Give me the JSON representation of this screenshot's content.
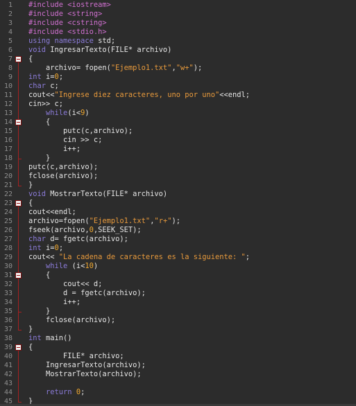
{
  "editor": {
    "language": "cpp",
    "colors": {
      "background": "#2c2c2c",
      "line_number": "#8f8f8f",
      "fold_marker": "#a82020",
      "preprocessor": "#d070d0",
      "keyword": "#8b7bd8",
      "string": "#e89a3c",
      "number": "#f0a830",
      "text": "#e6e6e6"
    },
    "fold_lines": [
      7,
      14,
      23,
      31,
      39
    ],
    "lines": [
      {
        "n": "1",
        "tokens": [
          [
            "pp",
            "#include <iostream>"
          ]
        ]
      },
      {
        "n": "2",
        "tokens": [
          [
            "pp",
            "#include <string>"
          ]
        ]
      },
      {
        "n": "3",
        "tokens": [
          [
            "pp",
            "#include <cstring>"
          ]
        ]
      },
      {
        "n": "4",
        "tokens": [
          [
            "pp",
            "#include <stdio.h>"
          ]
        ]
      },
      {
        "n": "5",
        "tokens": [
          [
            "kw",
            "using namespace "
          ],
          [
            "txt",
            "std;"
          ]
        ]
      },
      {
        "n": "6",
        "tokens": [
          [
            "ty",
            "void "
          ],
          [
            "txt",
            "IngresarTexto(FILE* archivo)"
          ]
        ]
      },
      {
        "n": "7",
        "tokens": [
          [
            "txt",
            "{"
          ]
        ]
      },
      {
        "n": "8",
        "tokens": [
          [
            "txt",
            "    archivo= fopen("
          ],
          [
            "str",
            "\"Ejemplo1.txt\""
          ],
          [
            "txt",
            ","
          ],
          [
            "str",
            "\"w+\""
          ],
          [
            "txt",
            ");"
          ]
        ]
      },
      {
        "n": "9",
        "tokens": [
          [
            "ty",
            "int "
          ],
          [
            "txt",
            "i="
          ],
          [
            "num",
            "0"
          ],
          [
            "txt",
            ";"
          ]
        ]
      },
      {
        "n": "10",
        "tokens": [
          [
            "ty",
            "char "
          ],
          [
            "txt",
            "c;"
          ]
        ]
      },
      {
        "n": "11",
        "tokens": [
          [
            "txt",
            "cout<<"
          ],
          [
            "str",
            "\"Ingrese diez caracteres, uno por uno\""
          ],
          [
            "txt",
            "<<endl;"
          ]
        ]
      },
      {
        "n": "12",
        "tokens": [
          [
            "txt",
            "cin>> c;"
          ]
        ]
      },
      {
        "n": "13",
        "tokens": [
          [
            "txt",
            "    "
          ],
          [
            "kw",
            "while"
          ],
          [
            "txt",
            "(i<"
          ],
          [
            "num",
            "9"
          ],
          [
            "txt",
            ")"
          ]
        ]
      },
      {
        "n": "14",
        "tokens": [
          [
            "txt",
            "    {"
          ]
        ]
      },
      {
        "n": "15",
        "tokens": [
          [
            "txt",
            "        putc(c,archivo);"
          ]
        ]
      },
      {
        "n": "16",
        "tokens": [
          [
            "txt",
            "        cin >> c;"
          ]
        ]
      },
      {
        "n": "17",
        "tokens": [
          [
            "txt",
            "        i++;"
          ]
        ]
      },
      {
        "n": "18",
        "tokens": [
          [
            "txt",
            "    }"
          ]
        ]
      },
      {
        "n": "19",
        "tokens": [
          [
            "txt",
            "putc(c,archivo);"
          ]
        ]
      },
      {
        "n": "20",
        "tokens": [
          [
            "txt",
            "fclose(archivo);"
          ]
        ]
      },
      {
        "n": "21",
        "tokens": [
          [
            "txt",
            "}"
          ]
        ]
      },
      {
        "n": "22",
        "tokens": [
          [
            "ty",
            "void "
          ],
          [
            "txt",
            "MostrarTexto(FILE* archivo)"
          ]
        ]
      },
      {
        "n": "23",
        "tokens": [
          [
            "txt",
            "{"
          ]
        ]
      },
      {
        "n": "24",
        "tokens": [
          [
            "txt",
            "cout<<endl;"
          ]
        ]
      },
      {
        "n": "25",
        "tokens": [
          [
            "txt",
            "archivo=fopen("
          ],
          [
            "str",
            "\"Ejemplo1.txt\""
          ],
          [
            "txt",
            ","
          ],
          [
            "str",
            "\"r+\""
          ],
          [
            "txt",
            ");"
          ]
        ]
      },
      {
        "n": "26",
        "tokens": [
          [
            "txt",
            "fseek(archivo,"
          ],
          [
            "num",
            "0"
          ],
          [
            "txt",
            ",SEEK_SET);"
          ]
        ]
      },
      {
        "n": "27",
        "tokens": [
          [
            "ty",
            "char "
          ],
          [
            "txt",
            "d= fgetc(archivo);"
          ]
        ]
      },
      {
        "n": "28",
        "tokens": [
          [
            "ty",
            "int "
          ],
          [
            "txt",
            "i="
          ],
          [
            "num",
            "0"
          ],
          [
            "txt",
            ";"
          ]
        ]
      },
      {
        "n": "29",
        "tokens": [
          [
            "txt",
            "cout<< "
          ],
          [
            "str",
            "\"La cadena de caracteres es la siguiente: \""
          ],
          [
            "txt",
            ";"
          ]
        ]
      },
      {
        "n": "30",
        "tokens": [
          [
            "txt",
            "    "
          ],
          [
            "kw",
            "while "
          ],
          [
            "txt",
            "(i<"
          ],
          [
            "num",
            "10"
          ],
          [
            "txt",
            ")"
          ]
        ]
      },
      {
        "n": "31",
        "tokens": [
          [
            "txt",
            "    {"
          ]
        ]
      },
      {
        "n": "32",
        "tokens": [
          [
            "txt",
            "        cout<< d;"
          ]
        ]
      },
      {
        "n": "33",
        "tokens": [
          [
            "txt",
            "        d = fgetc(archivo);"
          ]
        ]
      },
      {
        "n": "34",
        "tokens": [
          [
            "txt",
            "        i++;"
          ]
        ]
      },
      {
        "n": "35",
        "tokens": [
          [
            "txt",
            "    }"
          ]
        ]
      },
      {
        "n": "36",
        "tokens": [
          [
            "txt",
            "    fclose(archivo);"
          ]
        ]
      },
      {
        "n": "37",
        "tokens": [
          [
            "txt",
            "}"
          ]
        ]
      },
      {
        "n": "38",
        "tokens": [
          [
            "ty",
            "int "
          ],
          [
            "txt",
            "main()"
          ]
        ]
      },
      {
        "n": "39",
        "tokens": [
          [
            "txt",
            "{"
          ]
        ]
      },
      {
        "n": "40",
        "tokens": [
          [
            "txt",
            "        FILE* archivo;"
          ]
        ]
      },
      {
        "n": "41",
        "tokens": [
          [
            "txt",
            "    IngresarTexto(archivo);"
          ]
        ]
      },
      {
        "n": "42",
        "tokens": [
          [
            "txt",
            "    MostrarTexto(archivo);"
          ]
        ]
      },
      {
        "n": "43",
        "tokens": [
          [
            "txt",
            ""
          ]
        ]
      },
      {
        "n": "44",
        "tokens": [
          [
            "txt",
            "    "
          ],
          [
            "kw",
            "return "
          ],
          [
            "num",
            "0"
          ],
          [
            "txt",
            ";"
          ]
        ]
      },
      {
        "n": "45",
        "tokens": [
          [
            "txt",
            "}"
          ]
        ]
      }
    ]
  }
}
